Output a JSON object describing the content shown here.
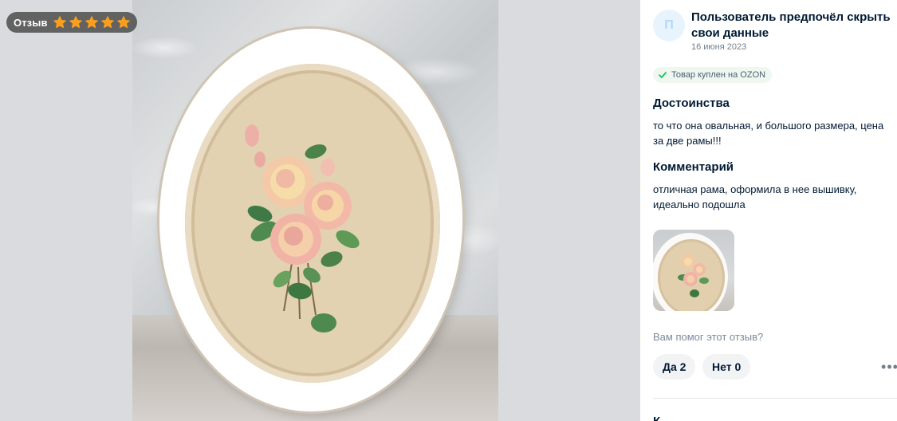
{
  "badge": {
    "label": "Отзыв",
    "rating": 5,
    "star_color": "#f8a01d"
  },
  "review": {
    "avatar_initial": "П",
    "author": "Пользователь предпочёл скрыть свои данные",
    "date": "16 июня 2023",
    "bought_label": "Товар куплен на OZON",
    "sections": [
      {
        "title": "Достоинства",
        "text": "то что она овальная, и большого размера, цена за две рамы!!!"
      },
      {
        "title": "Комментарий",
        "text": "отличная рама, оформила в нее вышивку, идеально подошла"
      }
    ],
    "helpful_question": "Вам помог этот отзыв?",
    "yes_button": "Да 2",
    "no_button": "Нет 0",
    "more_icon": "ellipsis-icon",
    "next_title_partial": "К"
  },
  "colors": {
    "accent_blue": "#005bff",
    "text_primary": "#001a34",
    "text_secondary": "#707f8d",
    "bought_bg": "#eef8f1",
    "check_green": "#10c44c"
  }
}
